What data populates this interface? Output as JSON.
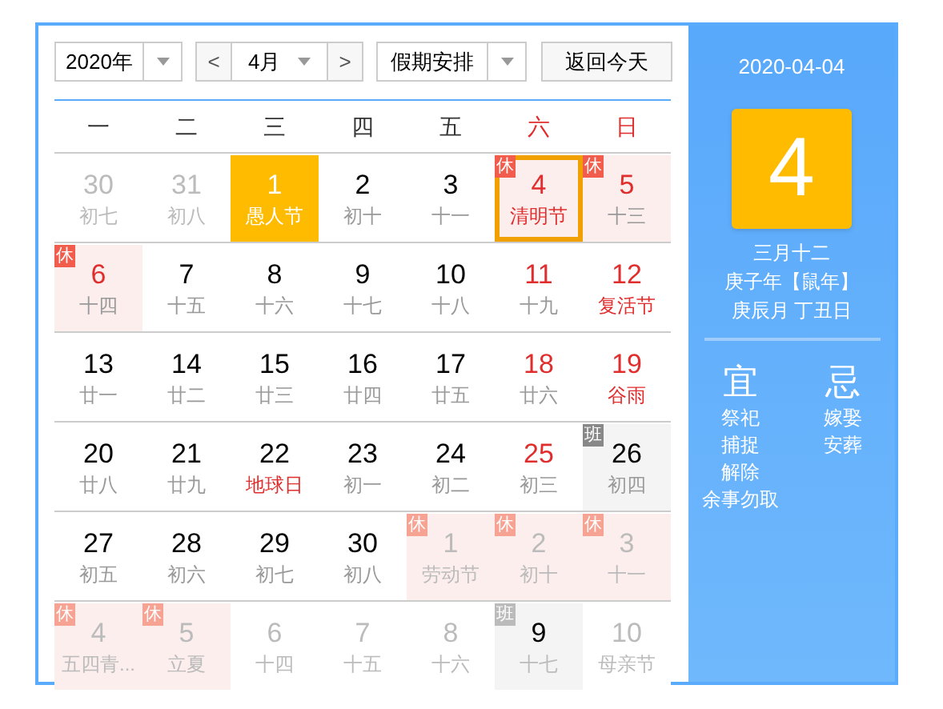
{
  "toolbar": {
    "year": "2020年",
    "prev": "<",
    "month": "4月",
    "next": ">",
    "holiday_select": "假期安排",
    "today_button": "返回今天"
  },
  "weekdays": [
    {
      "label": "一",
      "weekend": false
    },
    {
      "label": "二",
      "weekend": false
    },
    {
      "label": "三",
      "weekend": false
    },
    {
      "label": "四",
      "weekend": false
    },
    {
      "label": "五",
      "weekend": false
    },
    {
      "label": "六",
      "weekend": true
    },
    {
      "label": "日",
      "weekend": true
    }
  ],
  "weeks": [
    [
      {
        "day": "30",
        "sub": "初七",
        "kind": "muted",
        "other_month": true,
        "selected": false,
        "today": false
      },
      {
        "day": "31",
        "sub": "初八",
        "kind": "muted",
        "other_month": true,
        "selected": false,
        "today": false
      },
      {
        "day": "1",
        "sub": "愚人节",
        "kind": "normal",
        "other_month": false,
        "festival": true,
        "selected": false,
        "today": true
      },
      {
        "day": "2",
        "sub": "初十",
        "kind": "normal",
        "other_month": false,
        "festival": false,
        "selected": false,
        "today": false
      },
      {
        "day": "3",
        "sub": "十一",
        "kind": "normal",
        "other_month": false,
        "festival": false,
        "selected": false,
        "today": false
      },
      {
        "day": "4",
        "sub": "清明节",
        "kind": "red",
        "other_month": false,
        "festival": true,
        "badge": "休",
        "work_day": false,
        "selected": true,
        "today": false
      },
      {
        "day": "5",
        "sub": "十三",
        "kind": "red",
        "other_month": false,
        "festival": false,
        "badge": "休",
        "work_day": false,
        "selected": false,
        "today": false
      }
    ],
    [
      {
        "day": "6",
        "sub": "十四",
        "kind": "red",
        "other_month": false,
        "festival": false,
        "badge": "休",
        "work_day": false,
        "selected": false,
        "today": false
      },
      {
        "day": "7",
        "sub": "十五",
        "kind": "normal",
        "other_month": false,
        "festival": false,
        "selected": false,
        "today": false
      },
      {
        "day": "8",
        "sub": "十六",
        "kind": "normal",
        "other_month": false,
        "festival": false,
        "selected": false,
        "today": false
      },
      {
        "day": "9",
        "sub": "十七",
        "kind": "normal",
        "other_month": false,
        "festival": false,
        "selected": false,
        "today": false
      },
      {
        "day": "10",
        "sub": "十八",
        "kind": "normal",
        "other_month": false,
        "festival": false,
        "selected": false,
        "today": false
      },
      {
        "day": "11",
        "sub": "十九",
        "kind": "red",
        "other_month": false,
        "festival": false,
        "selected": false,
        "today": false
      },
      {
        "day": "12",
        "sub": "复活节",
        "kind": "red",
        "other_month": false,
        "festival": true,
        "selected": false,
        "today": false
      }
    ],
    [
      {
        "day": "13",
        "sub": "廿一",
        "kind": "normal",
        "other_month": false,
        "festival": false,
        "selected": false,
        "today": false
      },
      {
        "day": "14",
        "sub": "廿二",
        "kind": "normal",
        "other_month": false,
        "festival": false,
        "selected": false,
        "today": false
      },
      {
        "day": "15",
        "sub": "廿三",
        "kind": "normal",
        "other_month": false,
        "festival": false,
        "selected": false,
        "today": false
      },
      {
        "day": "16",
        "sub": "廿四",
        "kind": "normal",
        "other_month": false,
        "festival": false,
        "selected": false,
        "today": false
      },
      {
        "day": "17",
        "sub": "廿五",
        "kind": "normal",
        "other_month": false,
        "festival": false,
        "selected": false,
        "today": false
      },
      {
        "day": "18",
        "sub": "廿六",
        "kind": "red",
        "other_month": false,
        "festival": false,
        "selected": false,
        "today": false
      },
      {
        "day": "19",
        "sub": "谷雨",
        "kind": "red",
        "other_month": false,
        "festival": true,
        "selected": false,
        "today": false
      }
    ],
    [
      {
        "day": "20",
        "sub": "廿八",
        "kind": "normal",
        "other_month": false,
        "festival": false,
        "selected": false,
        "today": false
      },
      {
        "day": "21",
        "sub": "廿九",
        "kind": "normal",
        "other_month": false,
        "festival": false,
        "selected": false,
        "today": false
      },
      {
        "day": "22",
        "sub": "地球日",
        "kind": "normal",
        "other_month": false,
        "festival": true,
        "selected": false,
        "today": false
      },
      {
        "day": "23",
        "sub": "初一",
        "kind": "normal",
        "other_month": false,
        "festival": false,
        "selected": false,
        "today": false
      },
      {
        "day": "24",
        "sub": "初二",
        "kind": "normal",
        "other_month": false,
        "festival": false,
        "selected": false,
        "today": false
      },
      {
        "day": "25",
        "sub": "初三",
        "kind": "red",
        "other_month": false,
        "festival": false,
        "selected": false,
        "today": false
      },
      {
        "day": "26",
        "sub": "初四",
        "kind": "normal",
        "other_month": false,
        "festival": false,
        "badge": "班",
        "work_day": true,
        "selected": false,
        "today": false
      }
    ],
    [
      {
        "day": "27",
        "sub": "初五",
        "kind": "normal",
        "other_month": false,
        "festival": false,
        "selected": false,
        "today": false
      },
      {
        "day": "28",
        "sub": "初六",
        "kind": "normal",
        "other_month": false,
        "festival": false,
        "selected": false,
        "today": false
      },
      {
        "day": "29",
        "sub": "初七",
        "kind": "normal",
        "other_month": false,
        "festival": false,
        "selected": false,
        "today": false
      },
      {
        "day": "30",
        "sub": "初八",
        "kind": "normal",
        "other_month": false,
        "festival": false,
        "selected": false,
        "today": false
      },
      {
        "day": "1",
        "sub": "劳动节",
        "kind": "muted",
        "other_month": true,
        "badge": "休",
        "work_day": false,
        "selected": false,
        "today": false
      },
      {
        "day": "2",
        "sub": "初十",
        "kind": "muted",
        "other_month": true,
        "badge": "休",
        "work_day": false,
        "selected": false,
        "today": false
      },
      {
        "day": "3",
        "sub": "十一",
        "kind": "muted",
        "other_month": true,
        "badge": "休",
        "work_day": false,
        "selected": false,
        "today": false
      }
    ],
    [
      {
        "day": "4",
        "sub": "五四青...",
        "kind": "muted",
        "other_month": true,
        "badge": "休",
        "work_day": false,
        "selected": false,
        "today": false
      },
      {
        "day": "5",
        "sub": "立夏",
        "kind": "muted",
        "other_month": true,
        "badge": "休",
        "work_day": false,
        "selected": false,
        "today": false
      },
      {
        "day": "6",
        "sub": "十四",
        "kind": "muted",
        "other_month": true,
        "selected": false,
        "today": false
      },
      {
        "day": "7",
        "sub": "十五",
        "kind": "muted",
        "other_month": true,
        "selected": false,
        "today": false
      },
      {
        "day": "8",
        "sub": "十六",
        "kind": "muted",
        "other_month": true,
        "selected": false,
        "today": false
      },
      {
        "day": "9",
        "sub": "十七",
        "kind": "normal",
        "other_month": true,
        "badge": "班",
        "work_day": true,
        "selected": false,
        "today": false
      },
      {
        "day": "10",
        "sub": "母亲节",
        "kind": "muted",
        "other_month": true,
        "selected": false,
        "today": false
      }
    ]
  ],
  "detail": {
    "date": "2020-04-04",
    "day": "4",
    "lunar_date": "三月十二",
    "year_line": "庚子年【鼠年】",
    "month_day_line": "庚辰月 丁丑日",
    "good_title": "宜",
    "good": [
      "祭祀",
      "捕捉",
      "解除",
      "余事勿取"
    ],
    "bad_title": "忌",
    "bad": [
      "嫁娶",
      "安葬"
    ]
  }
}
